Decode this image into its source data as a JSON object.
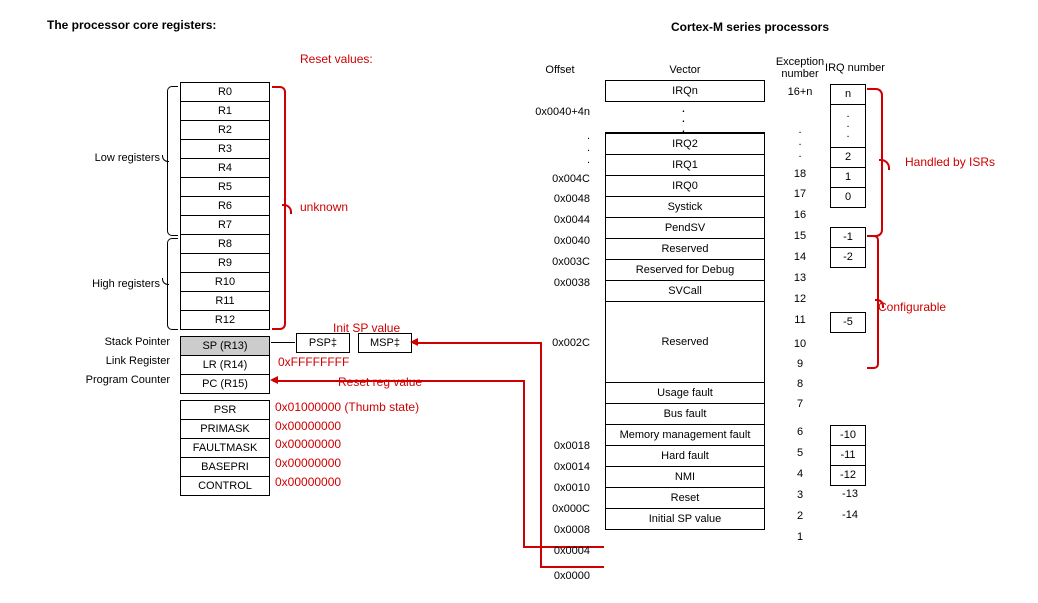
{
  "titles": {
    "left": "The processor core registers:",
    "right": "Cortex-M series processors",
    "reset_values": "Reset values:"
  },
  "left_labels": {
    "low": "Low registers",
    "high": "High registers",
    "sp": "Stack Pointer",
    "lr": "Link Register",
    "pc": "Program Counter",
    "unknown": "unknown"
  },
  "registers": {
    "gp": [
      "R0",
      "R1",
      "R2",
      "R3",
      "R4",
      "R5",
      "R6",
      "R7",
      "R8",
      "R9",
      "R10",
      "R11",
      "R12"
    ],
    "sp": "SP (R13)",
    "lr": "LR (R14)",
    "pc": "PC (R15)",
    "special": [
      "PSR",
      "PRIMASK",
      "FAULTMASK",
      "BASEPRI",
      "CONTROL"
    ]
  },
  "pspmsp": {
    "psp": "PSP‡",
    "msp": "MSP‡"
  },
  "reset_text": {
    "init_sp": "Init SP value",
    "lr": "0xFFFFFFFF",
    "reset_reg": "Reset reg value",
    "psr": "0x01000000 (Thumb state)",
    "zeros": "0x00000000"
  },
  "right_hdr": {
    "offset": "Offset",
    "vector": "Vector",
    "exc": "Exception number",
    "irq": "IRQ number"
  },
  "vectors": {
    "irqn": "IRQn",
    "irq2": "IRQ2",
    "irq1": "IRQ1",
    "irq0": "IRQ0",
    "systick": "Systick",
    "pendsv": "PendSV",
    "reserved": "Reserved",
    "debug": "Reserved for Debug",
    "svcall": "SVCall",
    "usage": "Usage fault",
    "bus": "Bus fault",
    "memm": "Memory management fault",
    "hard": "Hard fault",
    "nmi": "NMI",
    "reset": "Reset",
    "initsp": "Initial SP value"
  },
  "offsets": {
    "irqn": "0x0040+4n",
    "o4c": "0x004C",
    "o48": "0x0048",
    "o44": "0x0044",
    "o40": "0x0040",
    "o3c": "0x003C",
    "o38": "0x0038",
    "o2c": "0x002C",
    "o18": "0x0018",
    "o14": "0x0014",
    "o10": "0x0010",
    "o0c": "0x000C",
    "o08": "0x0008",
    "o04": "0x0004",
    "o00": "0x0000"
  },
  "exc": {
    "irqn": "16+n",
    "e18": "18",
    "e17": "17",
    "e16": "16",
    "e15": "15",
    "e14": "14",
    "e13": "13",
    "e12": "12",
    "e11": "11",
    "e10": "10",
    "e9": "9",
    "e8": "8",
    "e7": "7",
    "e6": "6",
    "e5": "5",
    "e4": "4",
    "e3": "3",
    "e2": "2",
    "e1": "1"
  },
  "irqcol": {
    "n": "n",
    "i2": "2",
    "i1": "1",
    "i0": "0",
    "m1": "-1",
    "m2": "-2",
    "m5": "-5",
    "m10": "-10",
    "m11": "-11",
    "m12": "-12",
    "m13": "-13",
    "m14": "-14"
  },
  "side": {
    "isrs": "Handled by ISRs",
    "config": "Configurable"
  },
  "dots": ". . ."
}
